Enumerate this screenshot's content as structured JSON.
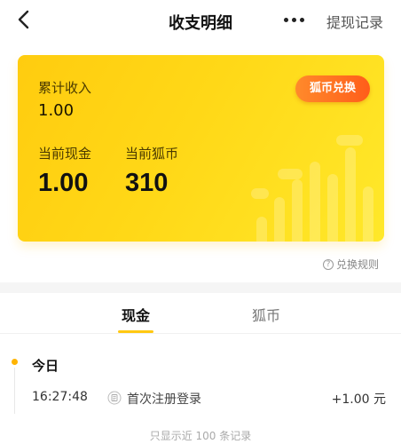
{
  "header": {
    "title": "收支明细",
    "more_icon": "more-dots-icon",
    "records_link": "提现记录",
    "back_icon": "chevron-left-icon"
  },
  "card": {
    "total_income_label": "累计收入",
    "total_income_value": "1.00",
    "exchange_button": "狐币兑换",
    "cash_label": "当前现金",
    "cash_value": "1.00",
    "coins_label": "当前狐币",
    "coins_value": "310",
    "gradient_start": "#ffcc0f",
    "gradient_end": "#ffe82a",
    "button_color": "#ff6a20"
  },
  "rules_link": {
    "label": "兑换规则",
    "icon": "question-circle-icon"
  },
  "tabs": [
    {
      "label": "现金",
      "active": true
    },
    {
      "label": "狐币",
      "active": false
    }
  ],
  "accent_color": "#ffc812",
  "transactions": {
    "date_label": "今日",
    "items": [
      {
        "time": "16:27:48",
        "icon": "document-icon",
        "description": "首次注册登录",
        "amount": "+1.00 元"
      }
    ]
  },
  "footer_note": "只显示近 100 条记录"
}
